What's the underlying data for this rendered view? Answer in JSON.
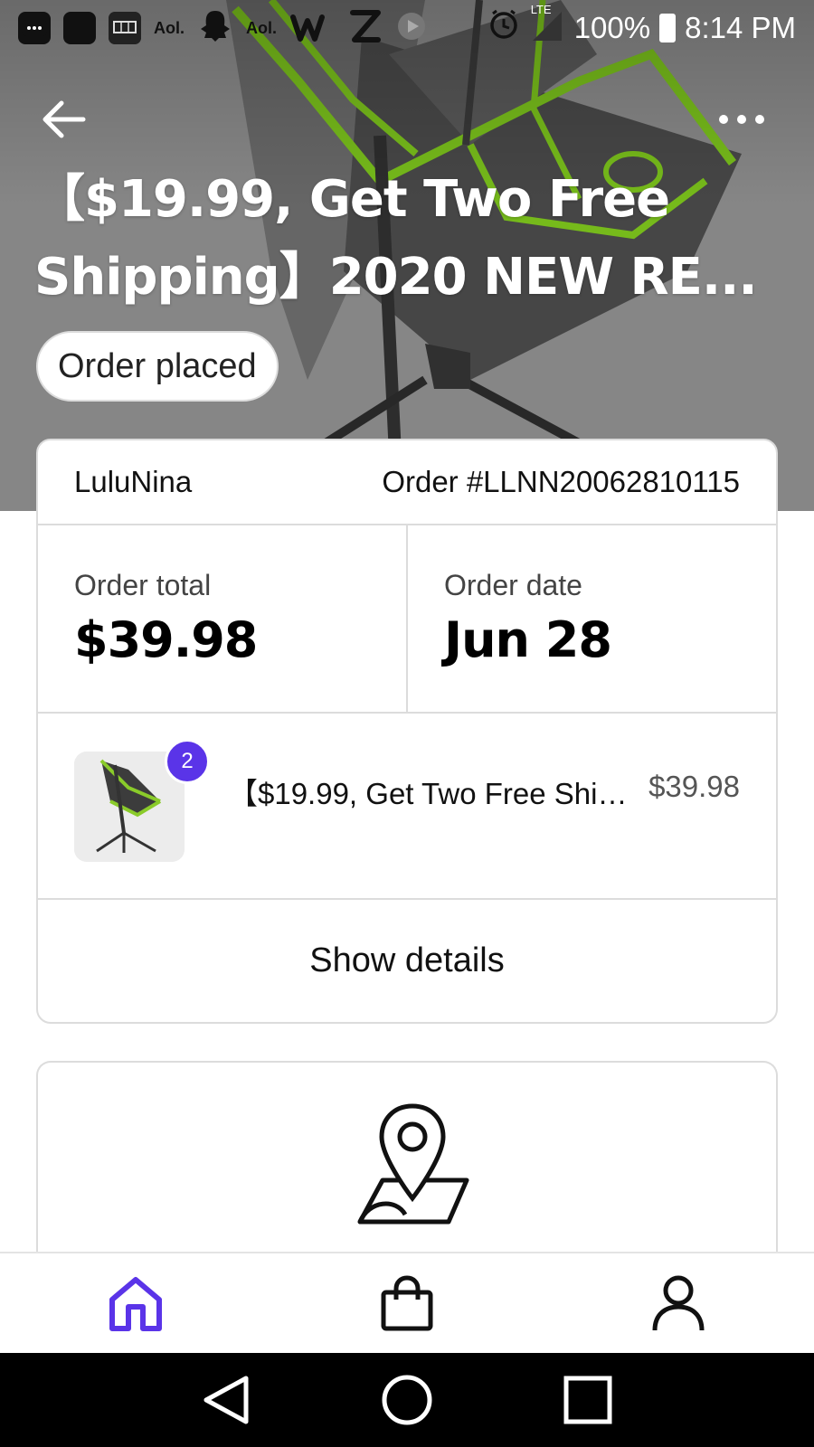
{
  "status_bar": {
    "notification_icons": [
      "more-icon",
      "app-icon",
      "slots-app-icon",
      "aol-icon",
      "snapchat-icon",
      "aol-icon",
      "words-app-icon",
      "zedge-icon",
      "media-icon"
    ],
    "aol_label": "Aol.",
    "network": "LTE",
    "battery": "100%",
    "time": "8:14 PM"
  },
  "header": {
    "back_icon": "arrow-left-icon",
    "more_icon": "more-horizontal-icon",
    "title": "【$19.99, Get Two Free Shipping】2020 NEW RE...",
    "status": "Order placed"
  },
  "order": {
    "shop": "LuluNina",
    "number": "Order #LLNN20062810115",
    "total_label": "Order total",
    "total_value": "$39.98",
    "date_label": "Order date",
    "date_value": "Jun 28",
    "item": {
      "quantity": "2",
      "name": "【$19.99, Get Two Free Shipping】2020 NEW RE...",
      "price": "$39.98"
    },
    "details_label": "Show details"
  },
  "shipping": {
    "icon": "map-pin-icon"
  },
  "bottom_nav": {
    "items": [
      {
        "icon": "home-icon",
        "active": true
      },
      {
        "icon": "shopping-bag-icon",
        "active": false
      },
      {
        "icon": "profile-icon",
        "active": false
      }
    ],
    "active_color": "#5a34e8"
  },
  "system_nav": [
    "back-triangle-icon",
    "home-circle-icon",
    "recents-square-icon"
  ]
}
